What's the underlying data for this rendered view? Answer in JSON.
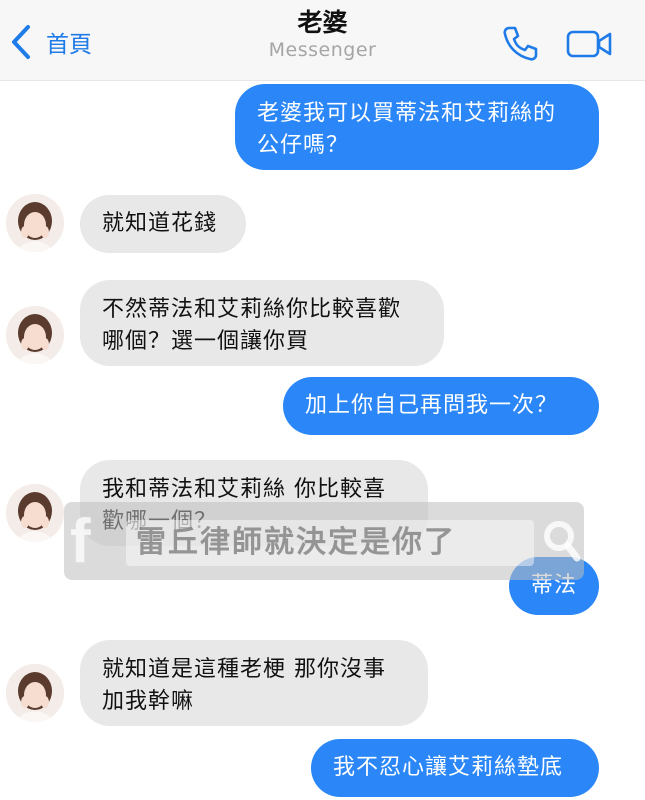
{
  "header": {
    "back_label": "首頁",
    "contact_name": "老婆",
    "app_name": "Messenger"
  },
  "messages": [
    {
      "from": "me",
      "text": "老婆我可以買蒂法和艾莉絲的\n公仔嗎？"
    },
    {
      "from": "her",
      "text": "就知道花錢"
    },
    {
      "from": "her",
      "text": "不然蒂法和艾莉絲你比較喜歡\n哪個？選一個讓你買"
    },
    {
      "from": "me",
      "text": "加上你自己再問我一次？"
    },
    {
      "from": "her",
      "text": "我和蒂法和艾莉絲 你比較喜\n歡哪一個？"
    },
    {
      "from": "me",
      "text": "蒂法"
    },
    {
      "from": "her",
      "text": "就知道是這種老梗 那你沒事\n加我幹嘛"
    },
    {
      "from": "me",
      "text": "我不忍心讓艾莉絲墊底"
    }
  ],
  "watermark": {
    "text": "雷丘律師就決定是你了",
    "logo_icon": "facebook-logo-icon",
    "search_icon": "search-icon"
  },
  "colors": {
    "outgoing_bubble": "#2b87f7",
    "incoming_bubble": "#e8e8e8",
    "accent": "#1f7be8"
  }
}
